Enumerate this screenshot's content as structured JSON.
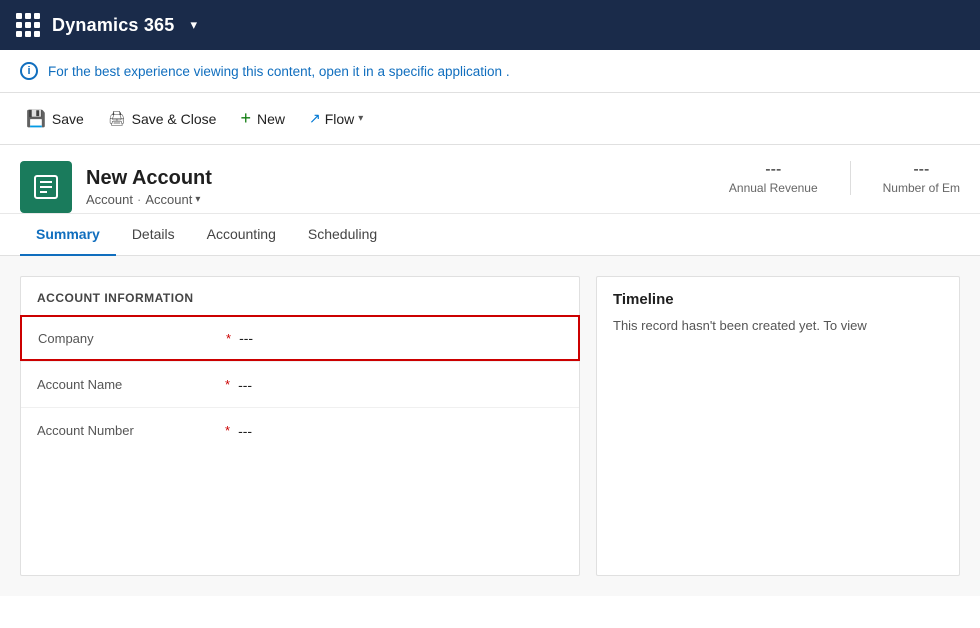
{
  "topnav": {
    "app_title": "Dynamics 365",
    "dropdown_label": "▾"
  },
  "banner": {
    "icon_label": "i",
    "message_before": "For the best experience viewing this content, open it in a",
    "link_text": "specific application",
    "message_after": "."
  },
  "toolbar": {
    "save_label": "Save",
    "save_close_label": "Save & Close",
    "new_label": "New",
    "flow_label": "Flow",
    "save_icon": "💾",
    "save_close_icon": "🖨",
    "new_icon": "+",
    "flow_icon": "↗"
  },
  "entity": {
    "title": "New Account",
    "breadcrumb_parent": "Account",
    "breadcrumb_current": "Account",
    "avatar_icon": "📋",
    "stat1_value": "---",
    "stat1_label": "Annual Revenue",
    "stat2_value": "---",
    "stat2_label": "Number of Em"
  },
  "tabs": [
    {
      "id": "summary",
      "label": "Summary",
      "active": true
    },
    {
      "id": "details",
      "label": "Details",
      "active": false
    },
    {
      "id": "accounting",
      "label": "Accounting",
      "active": false
    },
    {
      "id": "scheduling",
      "label": "Scheduling",
      "active": false
    }
  ],
  "account_section": {
    "title": "ACCOUNT INFORMATION",
    "fields": [
      {
        "label": "Company",
        "required": true,
        "value": "---",
        "highlighted": true
      },
      {
        "label": "Account Name",
        "required": true,
        "value": "---",
        "highlighted": false
      },
      {
        "label": "Account Number",
        "required": true,
        "value": "---",
        "highlighted": false
      }
    ]
  },
  "timeline": {
    "title": "Timeline",
    "empty_message": "This record hasn't been created yet.  To view"
  }
}
